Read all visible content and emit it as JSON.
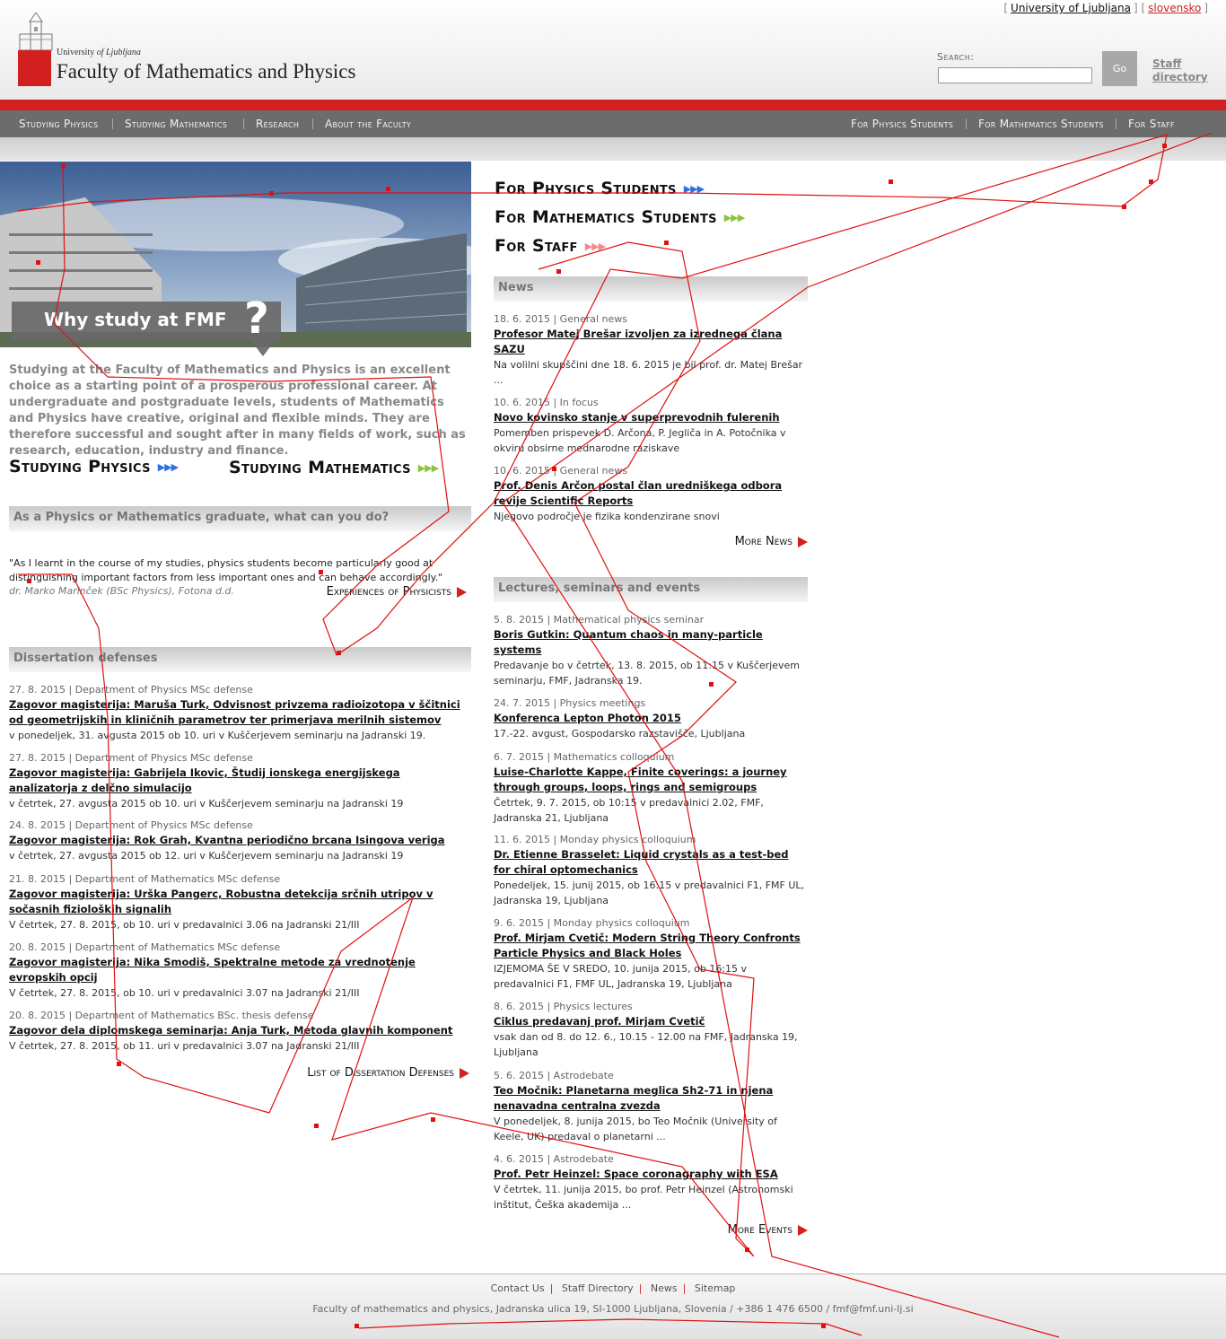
{
  "top_links": {
    "uni": "University of Ljubljana",
    "lang": "slovensko"
  },
  "header": {
    "uni_prefix": "University ",
    "uni_of": "of Ljubljana",
    "title": "Faculty of Mathematics and Physics",
    "search_label": "Search:",
    "go": "Go",
    "staff": "Staff directory"
  },
  "nav_left": [
    "Studying Physics",
    "Studying Mathematics",
    "Research",
    "About the Faculty"
  ],
  "nav_right": [
    "For Physics Students",
    "For Mathematics Students",
    "For Staff"
  ],
  "hero": {
    "why": "Why study at FMF",
    "q": "?"
  },
  "intro": "Studying at the Faculty of Mathematics and Physics is an excellent choice as a starting point of a prosperous professional career.  At undergraduate and postgraduate levels, students of Mathematics and Physics have creative, original and flexible minds.  They are therefore successful and sought after in many fields of work, such as research, education, industry and finance.",
  "study_physics": "Studying Physics",
  "study_math": "Studying Mathematics",
  "graduate_heading": "As a Physics or Mathematics graduate, what can you do?",
  "quote": "\"As I learnt in the course of my studies, physics students become particularly good at distinguishing important factors from less important ones and can behave accordingly.\"",
  "quote_author": "dr. Marko Marinček (BSc Physics), Fotona d.d.",
  "experiences": "Experiences of Physicists",
  "dissertation_heading": "Dissertation defenses",
  "dissertations": [
    {
      "meta": "27. 8. 2015 | Department of Physics MSc defense",
      "title": "Zagovor magisterija: Maruša Turk, Odvisnost privzema radioizotopa v ščitnici od geometrijskih in kliničnih parametrov ter primerjava merilnih sistemov",
      "desc": "v ponedeljek, 31. avgusta 2015 ob 10. uri v Kuščerjevem seminarju na Jadranski 19."
    },
    {
      "meta": "27. 8. 2015 | Department of Physics MSc defense",
      "title": "Zagovor magisterija: Gabrijela Ikovic, Študij ionskega energijskega analizatorja z delčno simulacijo",
      "desc": "v četrtek, 27. avgusta 2015 ob 10. uri v Kuščerjevem seminarju na Jadranski 19"
    },
    {
      "meta": "24. 8. 2015 | Department of Physics MSc defense",
      "title": "Zagovor magisterija: Rok Grah, Kvantna periodično brcana Isingova veriga",
      "desc": "v četrtek, 27. avgusta 2015 ob 12. uri v Kuščerjevem seminarju na Jadranski 19"
    },
    {
      "meta": "21. 8. 2015 | Department of Mathematics MSc defense",
      "title": "Zagovor magisterija: Urška Pangerc, Robustna detekcija srčnih utripov v sočasnih fizioloških signalih",
      "desc": "V četrtek, 27. 8. 2015, ob 10. uri v predavalnici 3.06 na Jadranski 21/III"
    },
    {
      "meta": "20. 8. 2015 | Department of Mathematics MSc defense",
      "title": "Zagovor magisterija: Nika Smodiš, Spektralne metode za vrednotenje evropskih opcij",
      "desc": "V četrtek, 27. 8. 2015, ob 10. uri v predavalnici 3.07 na Jadranski 21/III"
    },
    {
      "meta": "20. 8. 2015 | Department of Mathematics BSc. thesis defense",
      "title": "Zagovor dela diplomskega seminarja: Anja Turk, Metoda glavnih komponent",
      "desc": "V četrtek, 27. 8. 2015, ob 11. uri v predavalnici 3.07 na Jadranski 21/III"
    }
  ],
  "dissertation_list": "List of Dissertation Defenses",
  "for_physics": "For Physics Students",
  "for_math": "For Mathematics Students",
  "for_staff": "For Staff",
  "news_heading": "News",
  "news": [
    {
      "meta": "18. 6. 2015 | General news",
      "title": "Profesor Matej Brešar izvoljen za izrednega člana SAZU",
      "desc": "Na volilni skupščini dne 18. 6. 2015 je bil prof. dr. Matej Brešar ..."
    },
    {
      "meta": "10. 6. 2015 | In focus",
      "title": "Novo kovinsko stanje v superprevodnih fulerenih",
      "desc": "Pomemben prispevek D. Arčona, P. Jegliča in A. Potočnika v okviru obsirne mednarodne raziskave"
    },
    {
      "meta": "10. 6. 2015 | General news",
      "title": "Prof. Denis Arčon postal član uredniškega odbora revije Scientific Reports",
      "desc": "Njegovo področje je fizika kondenzirane snovi"
    }
  ],
  "more_news": "More News",
  "lectures_heading": "Lectures, seminars and events",
  "events": [
    {
      "meta": "5. 8. 2015 | Mathematical physics seminar",
      "title": "Boris Gutkin: Quantum chaos in many-particle systems",
      "desc": "Predavanje bo v četrtek, 13. 8. 2015, ob 11:15 v Kuščerjevem seminarju, FMF, Jadranska 19."
    },
    {
      "meta": "24. 7. 2015 | Physics meetings",
      "title": "Konferenca Lepton Photon 2015",
      "desc": "17.-22. avgust, Gospodarsko razstavišče, Ljubljana"
    },
    {
      "meta": "6. 7. 2015 | Mathematics colloquium",
      "title": "Luise-Charlotte Kappe, Finite coverings: a journey through groups, loops, rings and semigroups",
      "desc": "Četrtek, 9. 7. 2015, ob 10:15 v predavalnici 2.02, FMF, Jadranska 21, Ljubljana"
    },
    {
      "meta": "11. 6. 2015 | Monday physics colloquium",
      "title": "Dr. Etienne Brasselet: Liquid crystals as a test-bed for chiral optomechanics",
      "desc": "Ponedeljek, 15. junij 2015, ob 16:15 v predavalnici F1, FMF UL, Jadranska 19, Ljubljana"
    },
    {
      "meta": "9. 6. 2015 | Monday physics colloquium",
      "title": "Prof. Mirjam Cvetič: Modern String Theory Confronts Particle Physics and Black Holes",
      "desc": "IZJEMOMA ŠE V SREDO, 10. junija 2015, ob 16:15 v predavalnici F1, FMF UL, Jadranska 19, Ljubljana"
    },
    {
      "meta": "8. 6. 2015 | Physics lectures",
      "title": "Ciklus predavanj prof. Mirjam Cvetič",
      "desc": "vsak dan od 8. do 12. 6., 10.15 - 12.00 na FMF, Jadranska 19, Ljubljana"
    },
    {
      "meta": "5. 6. 2015 | Astrodebate",
      "title": "Teo Močnik: Planetarna meglica Sh2-71 in njena nenavadna centralna zvezda",
      "desc": "V ponedeljek, 8. junija 2015, bo Teo Močnik (University of Keele, UK) predaval o planetarni ..."
    },
    {
      "meta": "4. 6. 2015 | Astrodebate",
      "title": "Prof. Petr Heinzel: Space coronagraphy with ESA",
      "desc": "V četrtek, 11. junija 2015, bo prof. Petr Heinzel (Astronomski inštitut, Češka akademija ..."
    }
  ],
  "more_events": "More Events",
  "footer": {
    "links": [
      "Contact Us",
      "Staff Directory",
      "News",
      "Sitemap"
    ],
    "address": "Faculty of mathematics and physics, Jadranska ulica 19, SI-1000 Ljubljana, Slovenia / +386 1 476 6500 / fmf@fmf.uni-lj.si"
  },
  "colors": {
    "brand_red": "#d21f1f",
    "nav_gray": "#6c6c6c",
    "arrow_blue": "#2f6fe0",
    "arrow_green": "#8ac33c"
  }
}
